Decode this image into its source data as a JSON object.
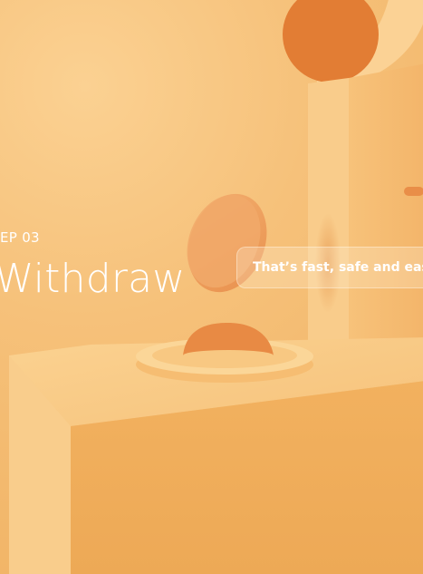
{
  "slide": {
    "step": "EP 03",
    "title": "Withdraw",
    "tagline": "That’s fast, safe and easy!"
  },
  "colors": {
    "background": "#f6c57c",
    "accent_orange": "#e27a2e",
    "text": "#ffffff"
  }
}
